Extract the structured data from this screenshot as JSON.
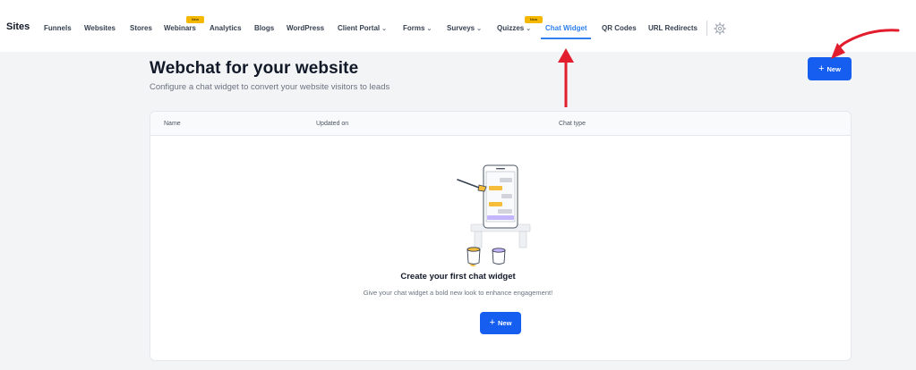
{
  "nav": {
    "brand": "Sites",
    "items": [
      {
        "label": "Funnels"
      },
      {
        "label": "Websites"
      },
      {
        "label": "Stores"
      },
      {
        "label": "Webinars",
        "badge": "New"
      },
      {
        "label": "Analytics"
      },
      {
        "label": "Blogs"
      },
      {
        "label": "WordPress"
      },
      {
        "label": "Client Portal",
        "chevron": "⌄"
      },
      {
        "label": "Forms",
        "chevron": "⌄"
      },
      {
        "label": "Surveys",
        "chevron": "⌄"
      },
      {
        "label": "Quizzes",
        "chevron": "⌄",
        "badge": "New"
      },
      {
        "label": "Chat Widget",
        "active": true
      },
      {
        "label": "QR Codes"
      },
      {
        "label": "URL Redirects"
      }
    ],
    "settings_icon": "gear-icon",
    "active_color": "#2f80ed"
  },
  "header": {
    "title": "Webchat for your website",
    "subtitle": "Configure a chat widget to convert your website visitors to leads",
    "new_button": {
      "plus": "+",
      "label": "New"
    }
  },
  "table": {
    "columns": [
      "Name",
      "Updated on",
      "Chat type"
    ]
  },
  "empty_state": {
    "illustration": "phone-chat-illustration",
    "title": "Create your first chat widget",
    "subtitle": "Give your chat widget a bold new look to enhance engagement!",
    "button": {
      "plus": "+",
      "label": "New"
    }
  },
  "colors": {
    "primary": "#155eef",
    "annotation_arrow": "#e11d2e",
    "badge": "#f5b800"
  }
}
